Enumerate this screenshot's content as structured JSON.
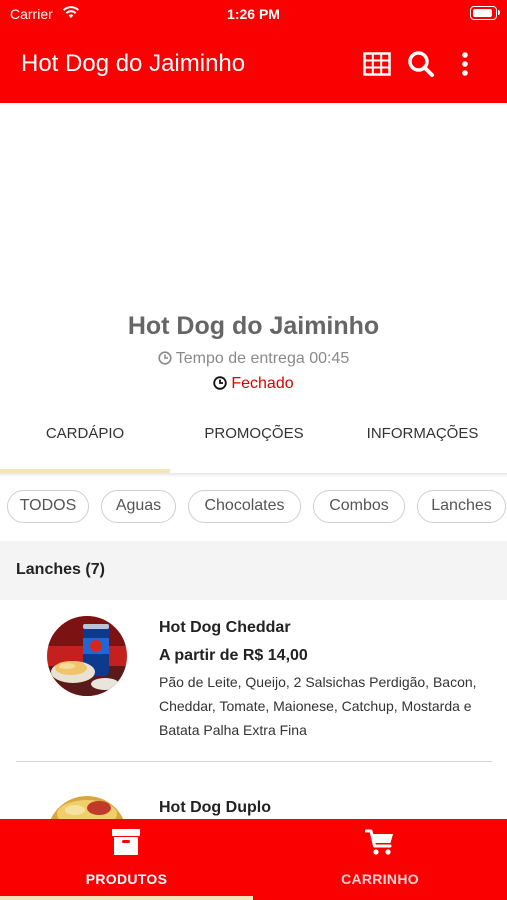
{
  "status_bar": {
    "carrier": "Carrier",
    "time": "1:26 PM"
  },
  "app_bar": {
    "title": "Hot Dog do Jaiminho",
    "actions": [
      "grid-icon",
      "search-icon",
      "more-vertical-icon"
    ]
  },
  "store": {
    "name": "Hot Dog do Jaiminho",
    "delivery_time": "Tempo de entrega 00:45",
    "status": "Fechado"
  },
  "tabs": [
    {
      "label": "CARDÁPIO",
      "selected": true
    },
    {
      "label": "PROMOÇÕES",
      "selected": false
    },
    {
      "label": "INFORMAÇÕES",
      "selected": false
    }
  ],
  "categories": [
    "TODOS",
    "Aguas",
    "Chocolates",
    "Combos",
    "Lanches"
  ],
  "section": {
    "title": "Lanches (7)"
  },
  "items": [
    {
      "name": "Hot Dog Cheddar",
      "price": "A partir de R$ 14,00",
      "description": "Pão de Leite, Queijo, 2 Salsichas Perdigão, Bacon, Cheddar, Tomate, Maionese, Catchup, Mostarda e Batata Palha Extra Fina"
    },
    {
      "name": "Hot Dog Duplo"
    }
  ],
  "bottom_nav": [
    {
      "label": "PRODUTOS",
      "icon": "archive-box-icon",
      "selected": true
    },
    {
      "label": "CARRINHO",
      "icon": "shopping-cart-icon",
      "selected": false
    }
  ],
  "colors": {
    "primary": "#fb0000",
    "indicator": "#f6e3b8",
    "closed": "#e00000"
  }
}
